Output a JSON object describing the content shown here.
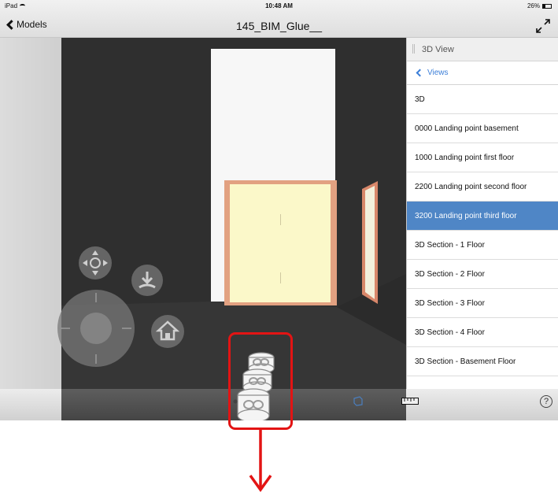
{
  "status_bar": {
    "carrier": "iPad",
    "time": "10:48 AM",
    "battery": "26%"
  },
  "nav": {
    "back_label": "Models",
    "title": "145_BIM_Glue__"
  },
  "panel": {
    "title": "3D View",
    "back_label": "Views",
    "items": [
      {
        "label": "3D"
      },
      {
        "label": "0000 Landing point basement"
      },
      {
        "label": "1000 Landing point first floor"
      },
      {
        "label": "2200 Landing point second floor"
      },
      {
        "label": "3200 Landing point third floor"
      },
      {
        "label": "3D Section - 1 Floor"
      },
      {
        "label": "3D Section - 2 Floor"
      },
      {
        "label": "3D Section - 3 Floor"
      },
      {
        "label": "3D Section - 4 Floor"
      },
      {
        "label": "3D Section - Basement Floor"
      }
    ],
    "selected_index": 4
  },
  "toolbar": {
    "help_label": "?"
  },
  "colors": {
    "accent": "#4f86c6",
    "link": "#3b7ed8",
    "annotation": "#e31414"
  },
  "icons": [
    "back-chevron-icon",
    "expand-icon",
    "pan-pad-icon",
    "look-down-icon",
    "home-icon",
    "elevation-level-icon",
    "section-cube-icon",
    "measure-ruler-icon",
    "help-icon"
  ]
}
